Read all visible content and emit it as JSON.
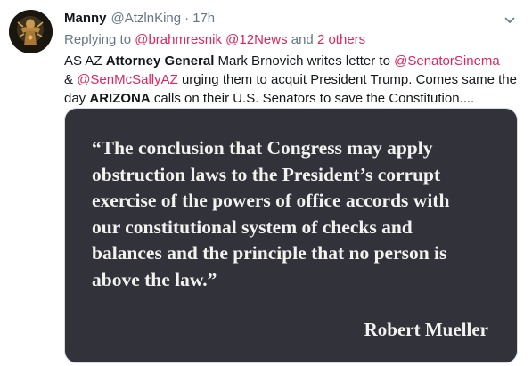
{
  "tweet": {
    "author_name": "Manny",
    "author_handle": "@AtzlnKing",
    "separator": "·",
    "timestamp": "17h",
    "reply_prefix": "Replying to ",
    "reply_to_1": "@brahmresnik",
    "reply_to_2": "@12News",
    "reply_join": " and ",
    "reply_others": "2 others",
    "body": {
      "t1": "AS AZ ",
      "b1": "Attorney General",
      "t2": " Mark Brnovich writes letter to ",
      "m1": "@SenatorSinema",
      "t3": "& ",
      "m2": "@SenMcSallyAZ",
      "t4": " urging them to acquit President Trump. Comes same the day ",
      "b2": "ARIZONA",
      "t5": " calls on their U.S. Senators to save the Constitution...."
    },
    "media": {
      "quote_lines": [
        "“The conclusion that Congress may apply",
        "obstruction laws to the President’s corrupt",
        "exercise of the powers of office accords with",
        "our constitutional system of checks and",
        "balances and the principle that no person is",
        "above the law.”"
      ],
      "attribution": "Robert Mueller"
    }
  },
  "icons": {
    "avatar": "avatar-image",
    "menu": "chevron-down-icon"
  },
  "colors": {
    "mention": "#e0245e",
    "secondary_text": "#657786",
    "media_background": "#32323a"
  }
}
